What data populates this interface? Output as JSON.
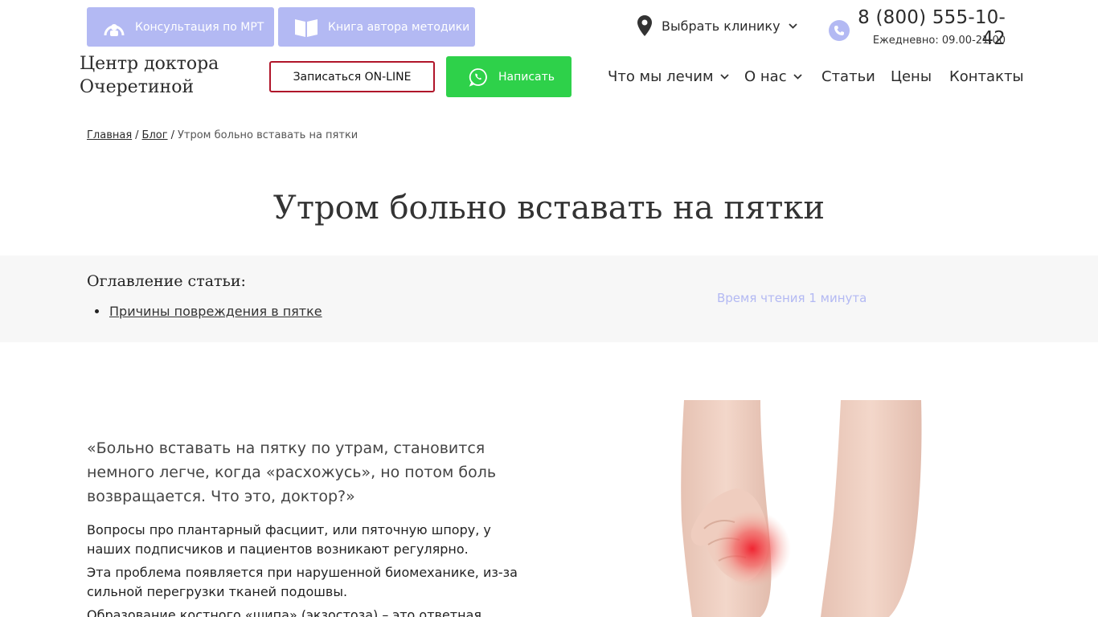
{
  "header": {
    "mri_button_label": "Консультация по МРТ",
    "book_button_label": "Книга автора методики",
    "clinic_select_label": "Выбрать клинику",
    "phone": "8 (800) 555-10-42",
    "hours": "Ежедневно: 09.00-21.00",
    "logo_line1": "Центр доктора",
    "logo_line2": "Очеретиной",
    "signup_button_label": "Записаться ON-LINE",
    "write_button_label": "Написать",
    "accent_color": "#b3b9f3",
    "signup_border_color": "#b0152a",
    "whatsapp_color": "#2ed14a"
  },
  "nav": {
    "items": [
      {
        "label": "Что мы лечим",
        "has_dropdown": true
      },
      {
        "label": "О нас",
        "has_dropdown": true
      },
      {
        "label": "Статьи",
        "has_dropdown": false
      },
      {
        "label": "Цены",
        "has_dropdown": false
      },
      {
        "label": "Контакты",
        "has_dropdown": false
      }
    ]
  },
  "breadcrumb": {
    "home": "Главная",
    "blog": "Блог",
    "current": "Утром больно вставать на пятки",
    "separator": "/"
  },
  "page": {
    "title": "Утром больно вставать на пятки"
  },
  "toc": {
    "title": "Оглавление статьи:",
    "items": [
      "Причины повреждения в пятке"
    ],
    "read_time": "Время чтения 1 минута"
  },
  "article": {
    "lead": "«Больно вставать на пятку по утрам, становится немного легче, когда «расхожусь», но потом боль возвращается. Что это, доктор?»",
    "paragraphs": [
      "Вопросы про плантарный фасциит, или пяточную шпору, у наших подписчиков и пациентов возникают регулярно.",
      "Эта проблема появляется при нарушенной биомеханике, из-за сильной перегрузки тканей подошвы.",
      "Образование костного «шипа» (экзостоза) – это ответная реакция"
    ],
    "image_icon": "heel-pain-photo"
  }
}
